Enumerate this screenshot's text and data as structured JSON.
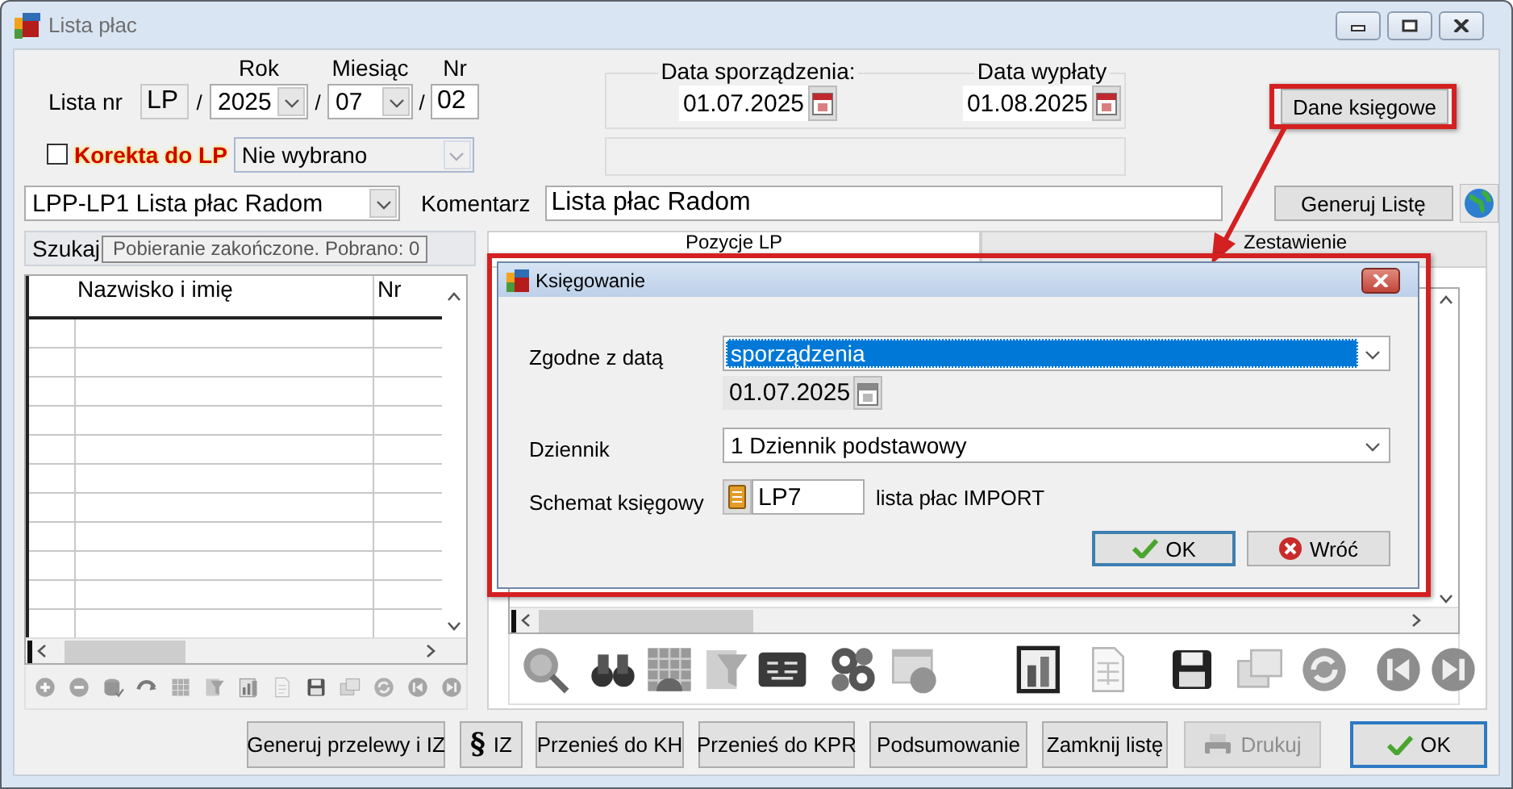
{
  "window": {
    "title": "Lista płac"
  },
  "list_number": {
    "label": "Lista nr",
    "prefix": "LP",
    "year_label": "Rok",
    "year": "2025",
    "month_label": "Miesiąc",
    "month": "07",
    "number_label": "Nr",
    "number": "02",
    "separators": [
      "/",
      "/",
      "/"
    ]
  },
  "correction": {
    "checked": false,
    "label": "Korekta do LP",
    "list": "Nie wybrano",
    "disabled": true
  },
  "dates": {
    "created_label": "Data sporządzenia:",
    "created": "01.07.2025",
    "paid_label": "Data wypłaty",
    "paid": "01.08.2025"
  },
  "accounting_button": {
    "label": "Dane księgowe",
    "highlighted": true
  },
  "template": {
    "value": "LPP-LP1 Lista płac Radom"
  },
  "comment": {
    "label": "Komentarz",
    "value": "Lista płac Radom"
  },
  "generate_button": {
    "label": "Generuj Listę"
  },
  "employees": {
    "search_label": "Szukaj",
    "status": "Pobieranie zakończone. Pobrano: 0",
    "columns": [
      "Nazwisko i imię",
      "Nr"
    ]
  },
  "tabs": [
    {
      "label": "Pozycje LP",
      "selected": true
    },
    {
      "label": "Zestawienie",
      "selected": false
    }
  ],
  "dialog": {
    "title": "Księgowanie",
    "highlighted": true,
    "date_basis_label": "Zgodne z datą",
    "date_basis": {
      "value": "sporządzenia",
      "selected": true
    },
    "date": "01.07.2025",
    "journal_label": "Dziennik",
    "journal": "1  Dziennik podstawowy",
    "scheme_label": "Schemat księgowy",
    "scheme_code": "LP7",
    "scheme_name": "lista płac IMPORT",
    "buttons": [
      {
        "label": "OK",
        "kind": "check",
        "default": true
      },
      {
        "label": "Wróć",
        "kind": "cancel",
        "default": false
      }
    ]
  },
  "buttons": [
    {
      "label": "Generuj przelewy i IZ",
      "kind": "plain",
      "disabled": false,
      "default": false
    },
    {
      "label": "IZ",
      "symbol": "§",
      "kind": "symbol",
      "disabled": false,
      "default": false
    },
    {
      "label": "Przenieś do KH",
      "kind": "plain",
      "disabled": false,
      "default": false
    },
    {
      "label": "Przenieś do KPR",
      "kind": "plain",
      "disabled": false,
      "default": false
    },
    {
      "label": "Podsumowanie",
      "kind": "plain",
      "disabled": false,
      "default": false
    },
    {
      "label": "Zamknij listę",
      "kind": "plain",
      "disabled": false,
      "default": false
    },
    {
      "label": "Drukuj",
      "kind": "printer",
      "disabled": true,
      "default": false
    },
    {
      "label": "OK",
      "kind": "check",
      "disabled": false,
      "default": true
    }
  ]
}
